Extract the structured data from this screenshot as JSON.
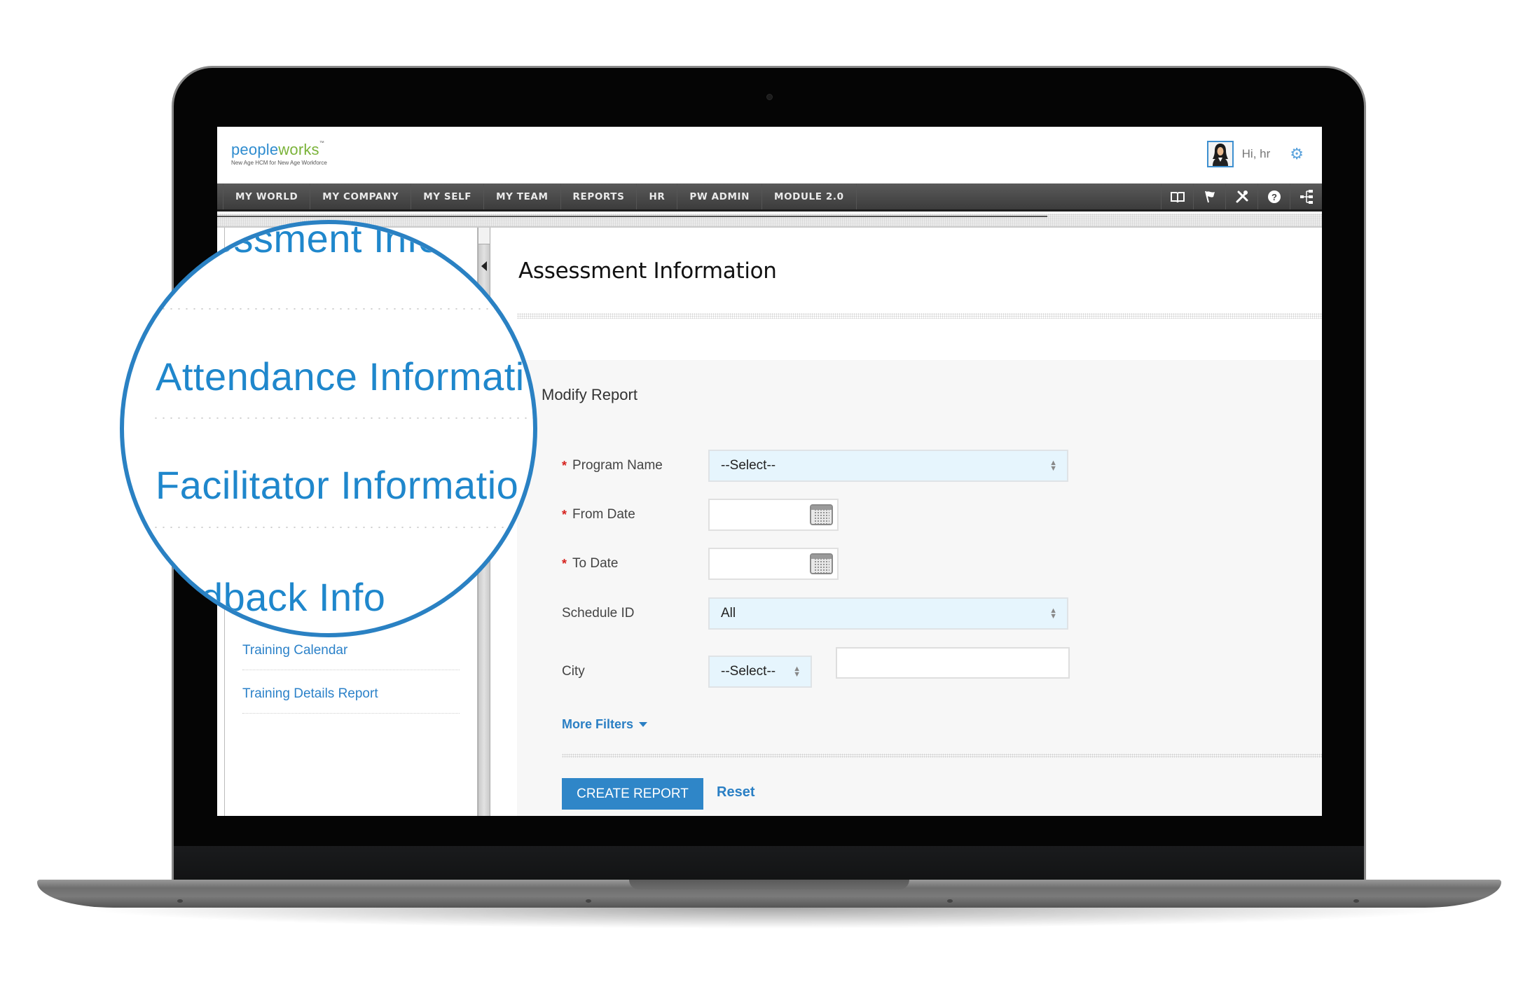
{
  "app": {
    "logo": {
      "part1": "pe",
      "part2": "o",
      "part3": "ple",
      "part4": "w",
      "part5": "o",
      "part6": "rks",
      "tm": "™",
      "tagline": "New Age HCM for New Age Workforce"
    },
    "user": {
      "greeting": "Hi, hr"
    }
  },
  "nav": {
    "items": [
      {
        "label": "MY WORLD"
      },
      {
        "label": "MY COMPANY"
      },
      {
        "label": "MY SELF"
      },
      {
        "label": "MY TEAM"
      },
      {
        "label": "REPORTS"
      },
      {
        "label": "HR"
      },
      {
        "label": "PW ADMIN"
      },
      {
        "label": "MODULE 2.0"
      }
    ],
    "icons": [
      {
        "name": "book-icon",
        "glyph": "🕮"
      },
      {
        "name": "flag-icon",
        "glyph": "⚑"
      },
      {
        "name": "tools-icon",
        "glyph": "✂"
      },
      {
        "name": "help-icon",
        "glyph": "❓"
      },
      {
        "name": "hierarchy-icon",
        "glyph": "⋮"
      }
    ]
  },
  "sidebar": {
    "items": [
      {
        "label": "Assessment Information"
      },
      {
        "label": "Attendance Information"
      },
      {
        "label": "Facilitator Information"
      },
      {
        "label": "Feedback Information"
      },
      {
        "label": "Training Calendar"
      },
      {
        "label": "Training Details Report"
      }
    ]
  },
  "magnifier": {
    "lines": [
      "Assessment Info",
      "Attendance Informati",
      "Facilitator Informatio",
      "dback Info"
    ]
  },
  "main": {
    "title": "Assessment Information",
    "panel_title": "Modify Report",
    "form": {
      "program_name": {
        "label": "Program Name",
        "required": true,
        "value": "--Select--"
      },
      "from_date": {
        "label": "From Date",
        "required": true,
        "value": ""
      },
      "to_date": {
        "label": "To Date",
        "required": true,
        "value": ""
      },
      "schedule_id": {
        "label": "Schedule ID",
        "required": false,
        "value": "All"
      },
      "city": {
        "label": "City",
        "required": false,
        "value": "--Select--",
        "text_value": ""
      },
      "required_marker": "*"
    },
    "more_filters": "More Filters",
    "create_button": "CREATE REPORT",
    "reset_link": "Reset"
  },
  "colors": {
    "accent": "#2f86c8",
    "link": "#2a7fc4",
    "navbar": "#3c3c3c",
    "select_bg": "#e6f5fd",
    "required": "#d6231f"
  }
}
